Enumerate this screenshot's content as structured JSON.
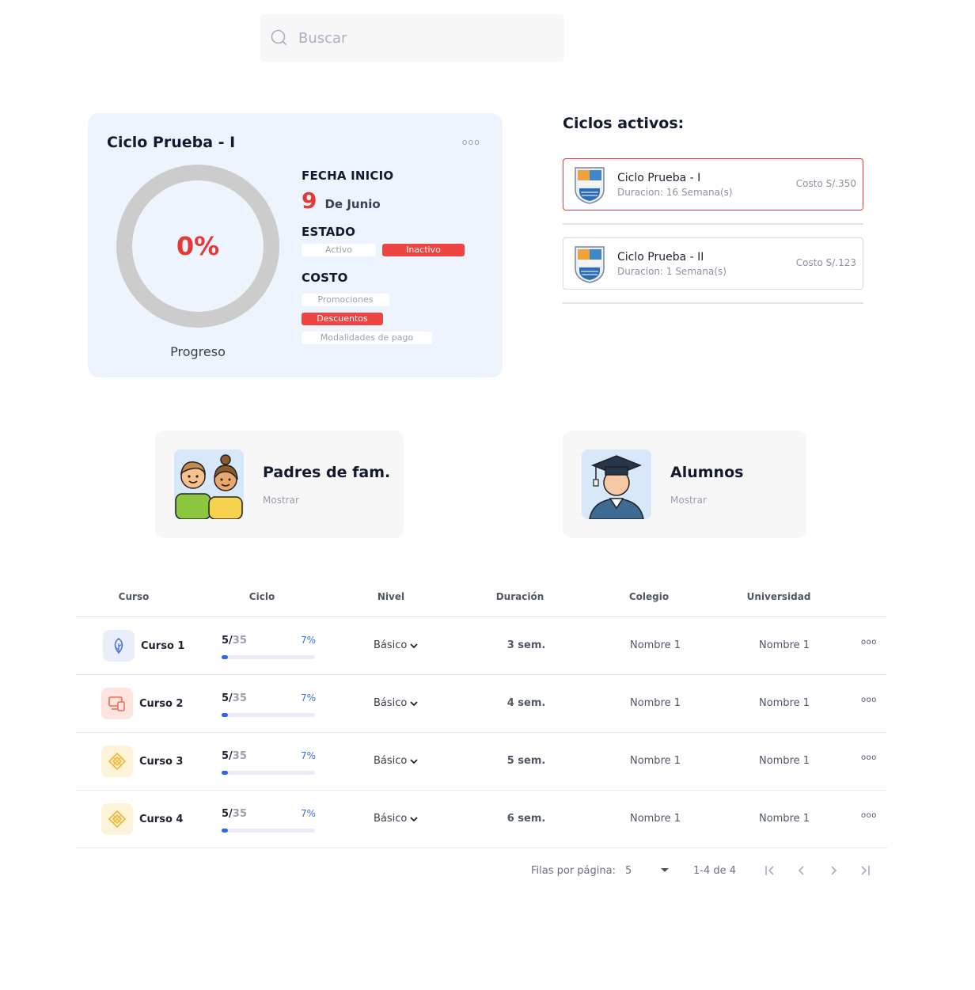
{
  "search": {
    "placeholder": "Buscar"
  },
  "cycle_card": {
    "title": "Ciclo Prueba - I",
    "more": "ooo",
    "progress_value": "0%",
    "progress_fraction": 0,
    "progress_label": "Progreso",
    "fecha_heading": "FECHA INICIO",
    "date_day": "9",
    "date_month": "De Junio",
    "estado_heading": "ESTADO",
    "estado_options": [
      "Activo",
      "Inactivo"
    ],
    "costo_heading": "COSTO",
    "costo_options": [
      "Promociones",
      "Descuentos",
      "Modalidades de pago"
    ]
  },
  "active_cycles": {
    "title": "Ciclos activos:",
    "items": [
      {
        "name": "Ciclo Prueba - I",
        "duration": "Duracion: 16 Semana(s)",
        "cost": "Costo S/.350"
      },
      {
        "name": "Ciclo Prueba - II",
        "duration": "Duracion: 1 Semana(s)",
        "cost": "Costo S/.123"
      }
    ]
  },
  "stats": [
    {
      "title": "Padres de fam.",
      "action": "Mostrar"
    },
    {
      "title": "Alumnos",
      "action": "Mostrar"
    }
  ],
  "table": {
    "headers": [
      "Curso",
      "Ciclo",
      "Nivel",
      "Duración",
      "Colegio",
      "Universidad"
    ],
    "rows": [
      {
        "course": "Curso 1",
        "done": "5",
        "total": "35",
        "percent": "7%",
        "level": "Básico",
        "duration": "3 sem.",
        "school": "Nombre 1",
        "university": "Nombre 1",
        "more": "ooo"
      },
      {
        "course": "Curso 2",
        "done": "5",
        "total": "35",
        "percent": "7%",
        "level": "Básico",
        "duration": "4 sem.",
        "school": "Nombre 1",
        "university": "Nombre 1",
        "more": "ooo"
      },
      {
        "course": "Curso 3",
        "done": "5",
        "total": "35",
        "percent": "7%",
        "level": "Básico",
        "duration": "5 sem.",
        "school": "Nombre 1",
        "university": "Nombre 1",
        "more": "ooo"
      },
      {
        "course": "Curso 4",
        "done": "5",
        "total": "35",
        "percent": "7%",
        "level": "Básico",
        "duration": "6 sem.",
        "school": "Nombre 1",
        "university": "Nombre 1",
        "more": "ooo"
      }
    ]
  },
  "pagination": {
    "rows_label": "Filas por página:",
    "rows_value": "5",
    "range": "1-4 de 4"
  },
  "colors": {
    "accent_red": "#e53935",
    "progress_blue": "#2f66e0",
    "card_bg": "#eef4fd"
  }
}
